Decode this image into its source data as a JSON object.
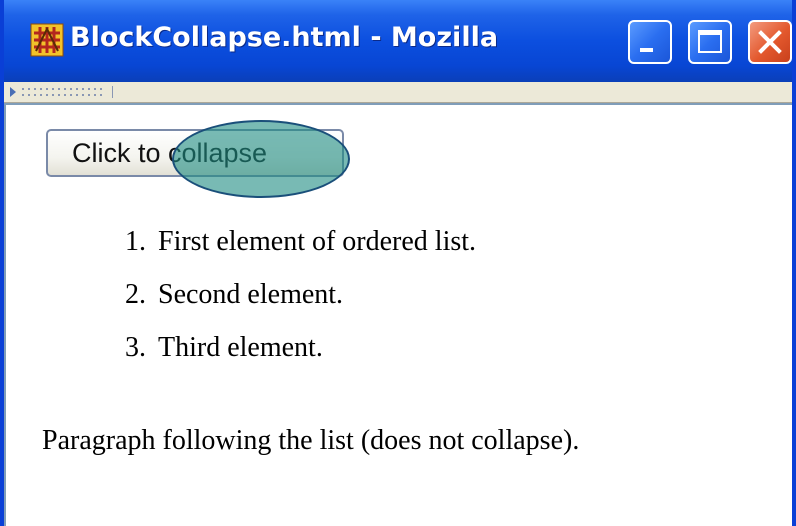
{
  "window": {
    "title": "BlockCollapse.html - Mozilla",
    "app_icon": "mozilla-app-icon"
  },
  "titlebar_buttons": [
    {
      "name": "minimize",
      "icon": "minimize-icon"
    },
    {
      "name": "maximize",
      "icon": "maximize-icon"
    },
    {
      "name": "close",
      "icon": "close-icon"
    }
  ],
  "content": {
    "button_label": "Click to collapse",
    "list_items": [
      {
        "number": "1.",
        "text": "First element of ordered list."
      },
      {
        "number": "2.",
        "text": "Second element."
      },
      {
        "number": "3.",
        "text": "Third element."
      }
    ],
    "paragraph": "Paragraph following the list (does not collapse)."
  },
  "colors": {
    "titlebar": "#0c4fdf",
    "window_border": "#0a3fd6",
    "close_button": "#e3582d",
    "highlight": "#1e8c82"
  }
}
